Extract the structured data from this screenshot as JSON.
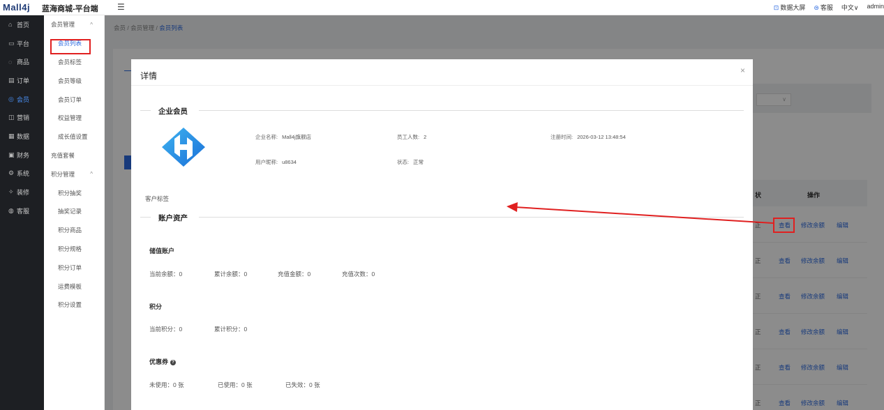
{
  "topbar": {
    "logo": "Mall4j",
    "app_title": "蓝海商城-平台端",
    "menu_toggle": "☰",
    "data_screen": "数据大屏",
    "service": "客服",
    "language": "中文∨",
    "user": "admin"
  },
  "nav": {
    "items": [
      {
        "label": "首页",
        "icon": "⌂"
      },
      {
        "label": "平台",
        "icon": "▭"
      },
      {
        "label": "商品",
        "icon": "◌"
      },
      {
        "label": "订单",
        "icon": "▤"
      },
      {
        "label": "会员",
        "icon": "◎"
      },
      {
        "label": "营销",
        "icon": "◫"
      },
      {
        "label": "数据",
        "icon": "▦"
      },
      {
        "label": "财务",
        "icon": "▣"
      },
      {
        "label": "系统",
        "icon": "⚙"
      },
      {
        "label": "装修",
        "icon": "✧"
      },
      {
        "label": "客服",
        "icon": "◍"
      }
    ]
  },
  "subnav": {
    "items": [
      {
        "label": "会员管理",
        "caret": "^"
      },
      {
        "label": "会员列表"
      },
      {
        "label": "会员标签"
      },
      {
        "label": "会员等级"
      },
      {
        "label": "会员订单"
      },
      {
        "label": "权益管理"
      },
      {
        "label": "成长值设置"
      },
      {
        "label": "充值套餐"
      },
      {
        "label": "积分管理",
        "caret": "^"
      },
      {
        "label": "积分抽奖"
      },
      {
        "label": "抽奖记录"
      },
      {
        "label": "积分商品"
      },
      {
        "label": "积分规格"
      },
      {
        "label": "积分订单"
      },
      {
        "label": "运费模板"
      },
      {
        "label": "积分设置"
      }
    ]
  },
  "breadcrumb": {
    "home": "会员",
    "sep1": "/",
    "mid": "会员管理",
    "sep2": "/",
    "current": "会员列表"
  },
  "table": {
    "status_header": "状",
    "op_header": "操作",
    "rows": [
      {
        "status": "正",
        "view": "查看",
        "edit_balance": "修改余额",
        "edit": "编辑"
      },
      {
        "status": "正",
        "view": "查看",
        "edit_balance": "修改余额",
        "edit": "编辑"
      },
      {
        "status": "正",
        "view": "查看",
        "edit_balance": "修改余额",
        "edit": "编辑"
      },
      {
        "status": "正",
        "view": "查看",
        "edit_balance": "修改余额",
        "edit": "编辑"
      },
      {
        "status": "正",
        "view": "查看",
        "edit_balance": "修改余额",
        "edit": "编辑"
      },
      {
        "status": "正",
        "view": "查看",
        "edit_balance": "修改余额",
        "edit": "编辑"
      }
    ]
  },
  "dialog": {
    "title": "详情",
    "close": "×",
    "enterprise_section": "企业会员",
    "company_name_label": "企业名称:",
    "company_name": "Mall4j旗舰店",
    "employee_label": "员工人数:",
    "employee_count": "2",
    "register_label": "注册时间:",
    "register_time": "2026-03-12 13:48:54",
    "nickname_label": "用户昵称:",
    "nickname": "u8634",
    "status_label": "状态:",
    "status": "正常",
    "customer_tag": "客户标签",
    "assets_section": "账户资产",
    "stored_title": "储值账户",
    "balance_current": "当前余额：0",
    "balance_total": "累计余额：0",
    "recharge_amount": "充值金额：0",
    "recharge_times": "充值次数：0",
    "points_title": "积分",
    "points_current": "当前积分：0",
    "points_total": "累计积分：0",
    "coupon_title": "优惠券",
    "coupon_unused": "未使用：0 张",
    "coupon_used": "已使用：0 张",
    "coupon_expired": "已失效：0 张"
  },
  "colors": {
    "brand": "#2d6be0",
    "highlight": "#e02020",
    "sidebar": "#1d1f23"
  }
}
